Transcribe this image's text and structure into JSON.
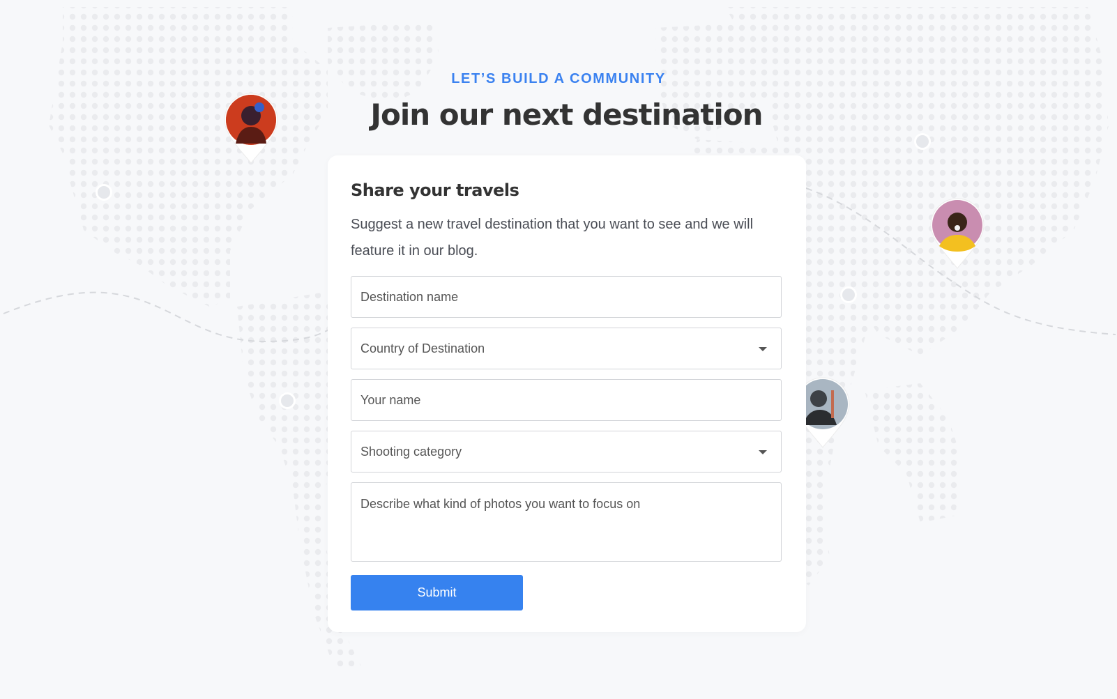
{
  "header": {
    "eyebrow": "LET’S BUILD A COMMUNITY",
    "title": "Join our next destination"
  },
  "form": {
    "title": "Share your travels",
    "description": "Suggest a new travel destination that you want to see and we will feature it in our blog.",
    "fields": {
      "destination_name": "Destination name",
      "country": "Country of Destination",
      "your_name": "Your name",
      "shooting_category": "Shooting category",
      "description": "Describe what kind of photos you want to focus on"
    },
    "submit_label": "Submit"
  },
  "colors": {
    "accent": "#3682ef",
    "headline": "#333333",
    "background": "#f7f8fa"
  },
  "icons": [
    "map-pin-icon",
    "chevron-down-icon",
    "avatar"
  ]
}
